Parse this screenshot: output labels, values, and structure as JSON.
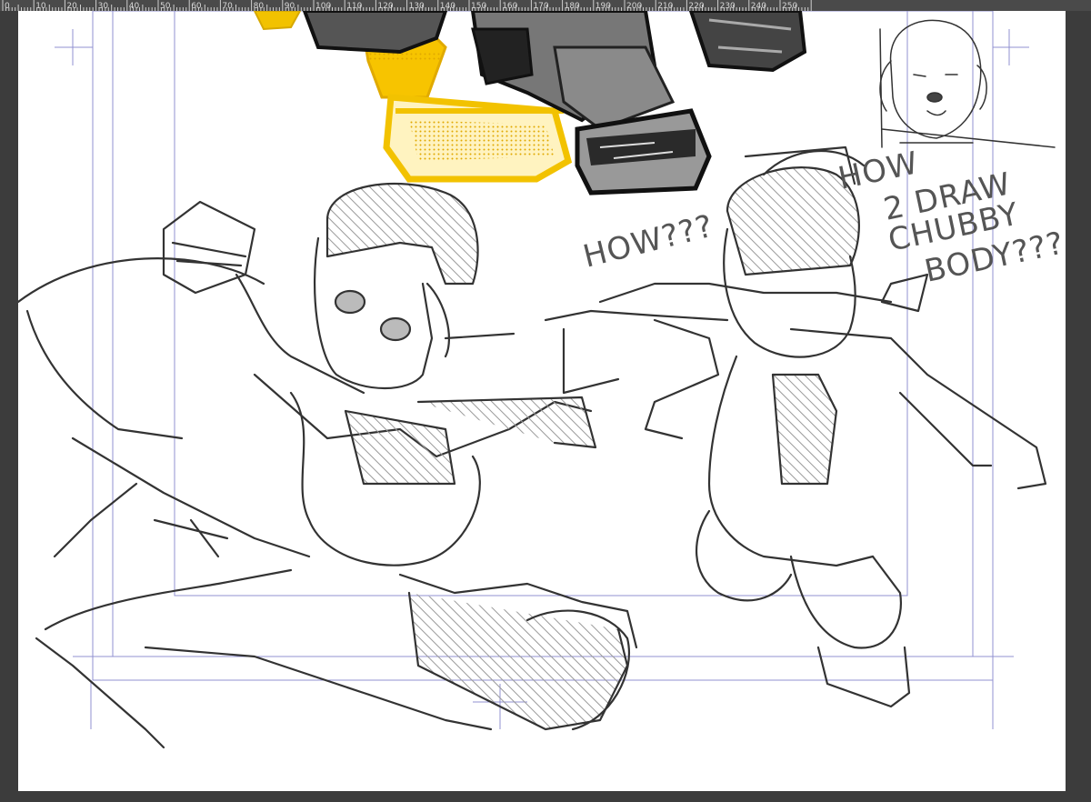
{
  "ruler": {
    "ticks": [
      "0",
      "10",
      "20",
      "30",
      "40",
      "50",
      "60",
      "70",
      "80",
      "90",
      "100",
      "110",
      "120",
      "130",
      "140",
      "150",
      "160",
      "170",
      "180",
      "190",
      "200",
      "210",
      "220",
      "230",
      "240",
      "250"
    ]
  },
  "notes": {
    "how_left": "HOW???",
    "how_right_1": "HOW",
    "how_right_2": "2 DRAW",
    "how_right_3": "CHUBBY",
    "how_right_4": "BODY???"
  },
  "colors": {
    "canvas": "#ffffff",
    "workspace": "#3c3c3c",
    "ruler_bg": "#4a4a4a",
    "guide": "#8f8fd0",
    "sketch_stroke": "#333333",
    "accent_yellow": "#f2c200"
  }
}
